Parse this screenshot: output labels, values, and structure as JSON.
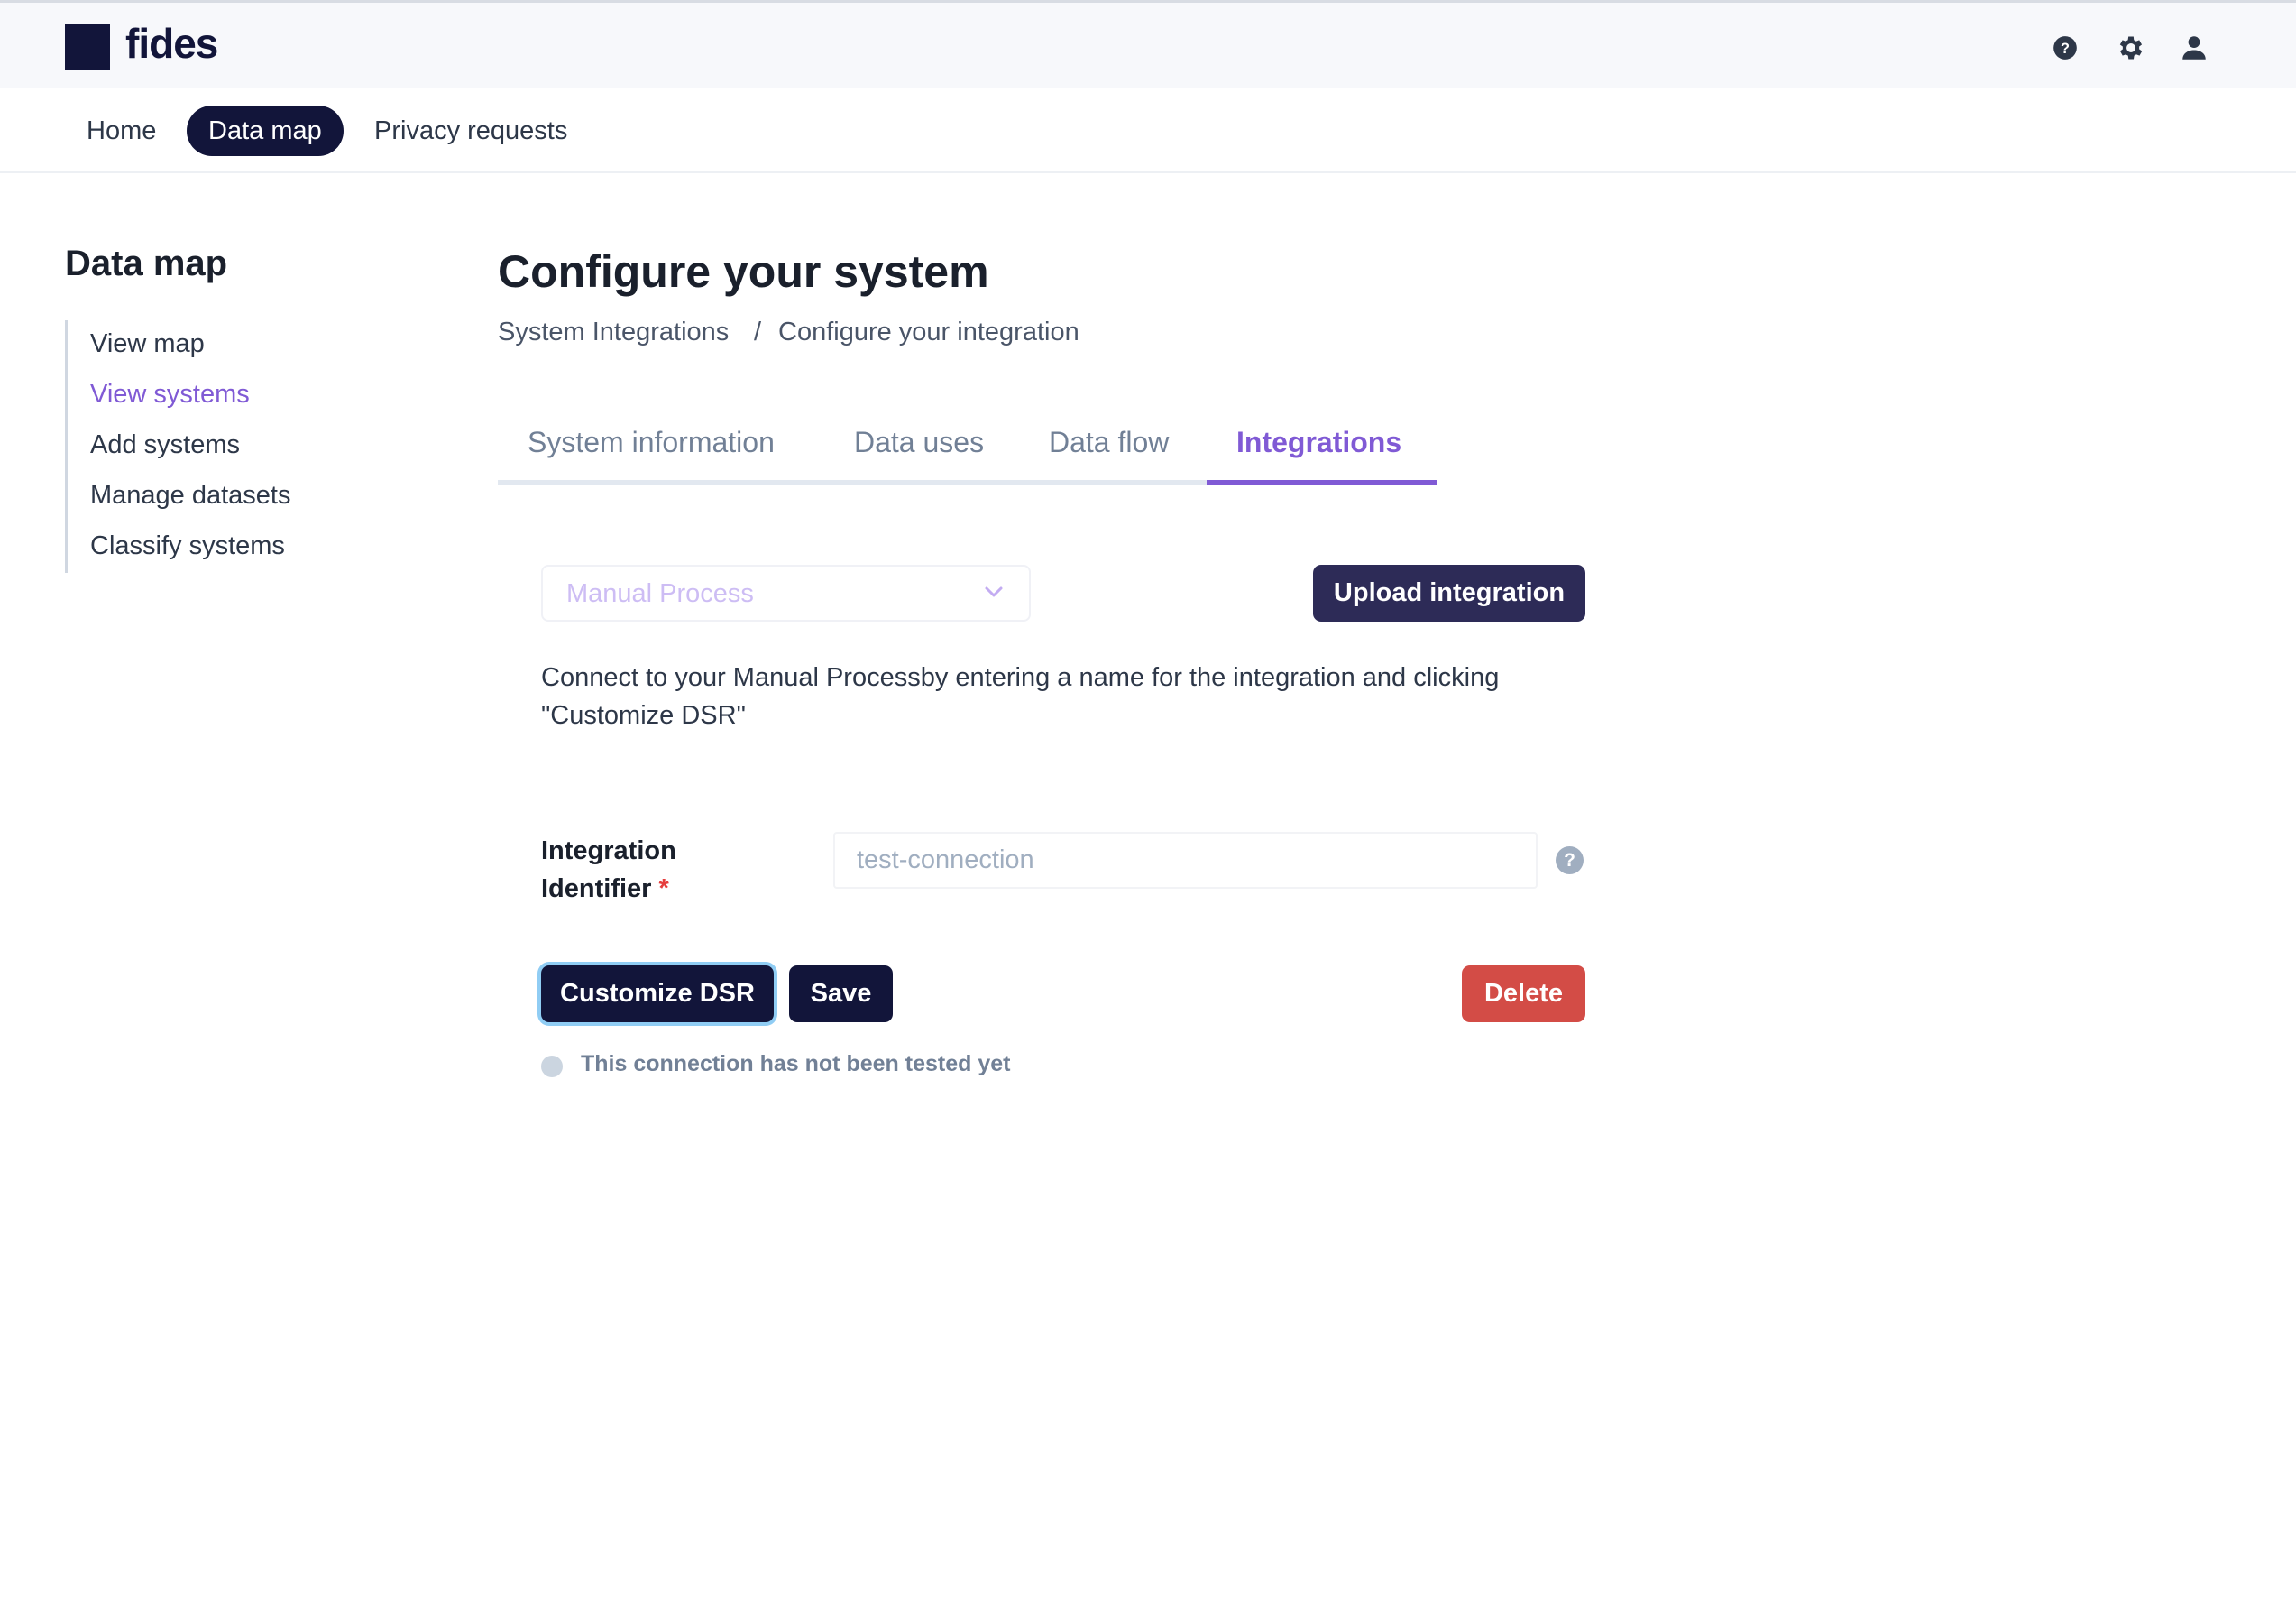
{
  "app": {
    "logo_text": "fides"
  },
  "header": {
    "icons": [
      {
        "name": "help-icon"
      },
      {
        "name": "gear-icon"
      },
      {
        "name": "user-icon"
      }
    ]
  },
  "nav": {
    "items": [
      {
        "label": "Home",
        "active": false
      },
      {
        "label": "Data map",
        "active": true
      },
      {
        "label": "Privacy requests",
        "active": false
      }
    ]
  },
  "sidebar": {
    "title": "Data map",
    "items": [
      {
        "label": "View map",
        "active": false
      },
      {
        "label": "View systems",
        "active": true
      },
      {
        "label": "Add systems",
        "active": false
      },
      {
        "label": "Manage datasets",
        "active": false
      },
      {
        "label": "Classify systems",
        "active": false
      }
    ]
  },
  "main": {
    "title": "Configure your system",
    "breadcrumb": {
      "first": "System Integrations",
      "separator": "/",
      "second": "Configure your integration"
    },
    "tabs": [
      {
        "label": "System information",
        "active": false
      },
      {
        "label": "Data uses",
        "active": false
      },
      {
        "label": "Data flow",
        "active": false
      },
      {
        "label": "Integrations",
        "active": true
      }
    ],
    "integration_select": {
      "value": "Manual Process"
    },
    "upload_button": "Upload integration",
    "description_line1": "Connect to your Manual Processby entering a name for the integration and clicking",
    "description_line2": "\"Customize DSR\"",
    "identifier": {
      "label_line1": "Integration",
      "label_line2": "Identifier",
      "required_mark": "*",
      "placeholder": "test-connection",
      "value": ""
    },
    "help_glyph": "?",
    "buttons": {
      "customize": "Customize DSR",
      "save": "Save",
      "delete": "Delete"
    },
    "status_text": "This connection has not been tested yet"
  },
  "colors": {
    "brand_dark": "#12153a",
    "accent_purple": "#805ad5",
    "danger": "#d34c46",
    "upload_button": "#2d2b57"
  }
}
